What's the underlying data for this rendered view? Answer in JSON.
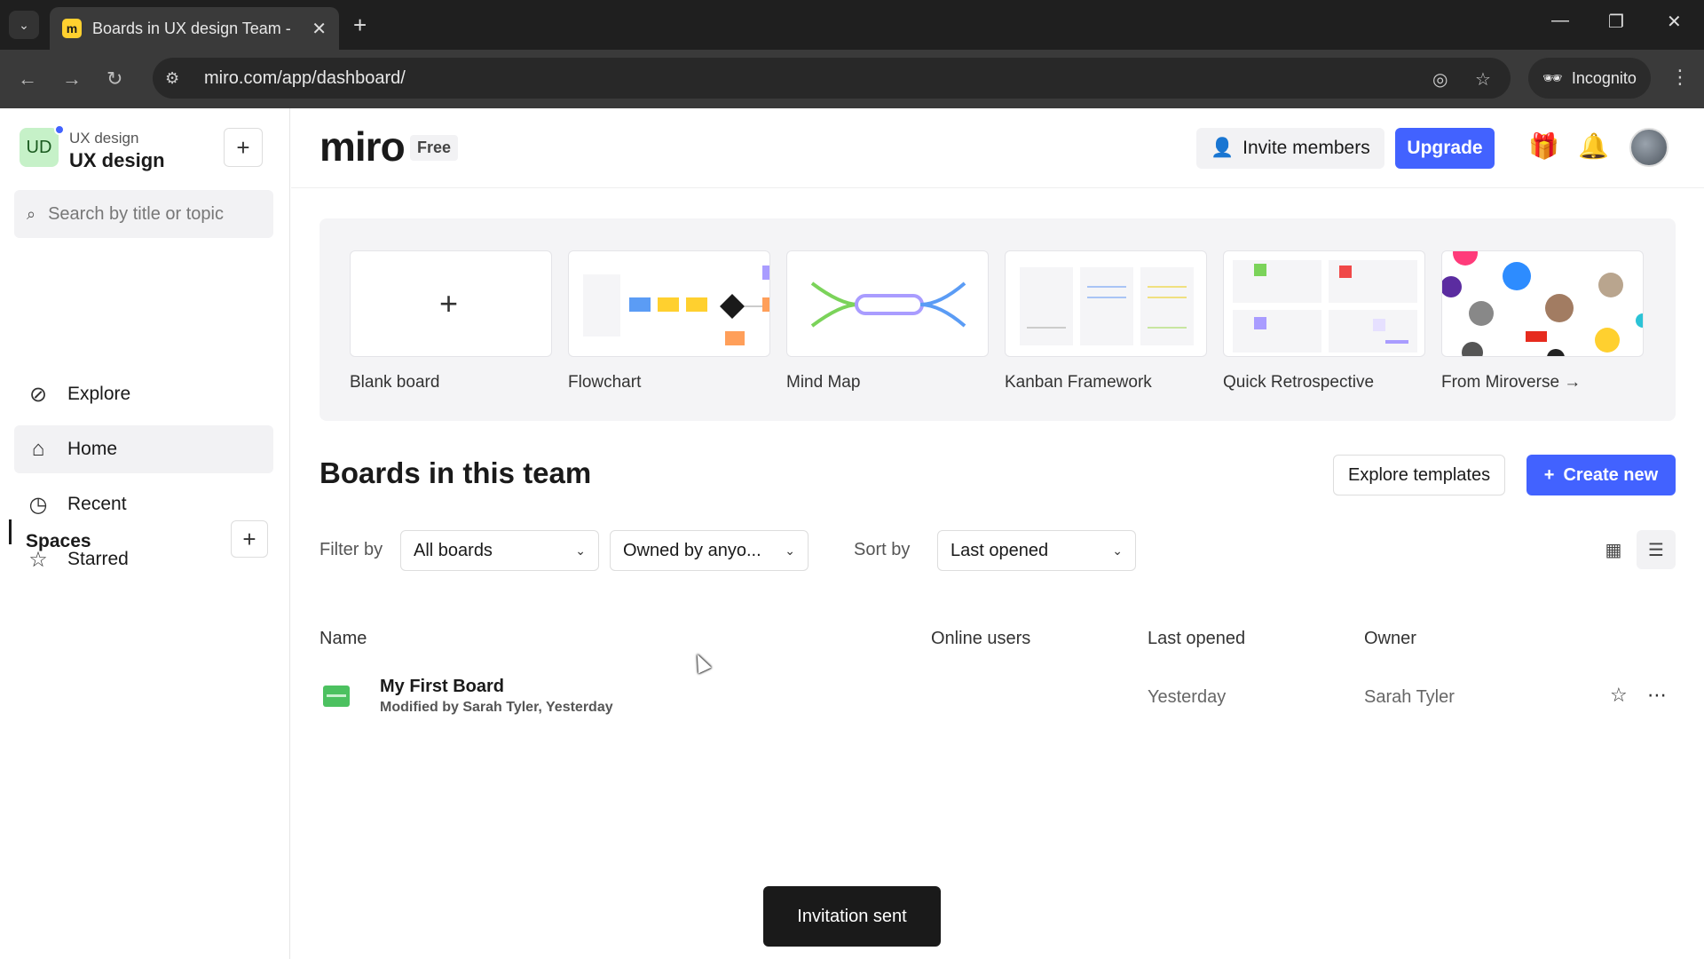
{
  "browser": {
    "tab_title": "Boards in UX design Team - Mir",
    "tab_favicon": "miro-favicon",
    "url": "miro.com/app/dashboard/",
    "incognito_label": "Incognito"
  },
  "sidebar": {
    "team_initials": "UD",
    "team_subtitle": "UX design",
    "team_name": "UX design",
    "search_placeholder": "Search by title or topic",
    "items": [
      {
        "label": "Explore",
        "icon": "compass-icon"
      },
      {
        "label": "Home",
        "icon": "home-icon"
      },
      {
        "label": "Recent",
        "icon": "clock-icon"
      },
      {
        "label": "Starred",
        "icon": "star-icon"
      }
    ],
    "spaces_label": "Spaces"
  },
  "header": {
    "logo": "miro",
    "plan": "Free",
    "invite_label": "Invite members",
    "upgrade_label": "Upgrade",
    "accent_color": "#4262ff"
  },
  "templates": [
    {
      "label": "Blank board"
    },
    {
      "label": "Flowchart"
    },
    {
      "label": "Mind Map"
    },
    {
      "label": "Kanban Framework"
    },
    {
      "label": "Quick Retrospective"
    },
    {
      "label": "From Miroverse →"
    }
  ],
  "boards_section": {
    "title": "Boards in this team",
    "explore_label": "Explore templates",
    "create_label": "Create new",
    "filter_label": "Filter by",
    "filter_boards": "All boards",
    "filter_owner": "Owned by anyo...",
    "sort_label": "Sort by",
    "sort_value": "Last opened"
  },
  "table": {
    "columns": [
      "Name",
      "Online users",
      "Last opened",
      "Owner"
    ],
    "rows": [
      {
        "name": "My First Board",
        "meta": "Modified by Sarah Tyler, Yesterday",
        "online": "",
        "last_opened": "Yesterday",
        "owner": "Sarah Tyler"
      }
    ]
  },
  "toast": "Invitation sent"
}
